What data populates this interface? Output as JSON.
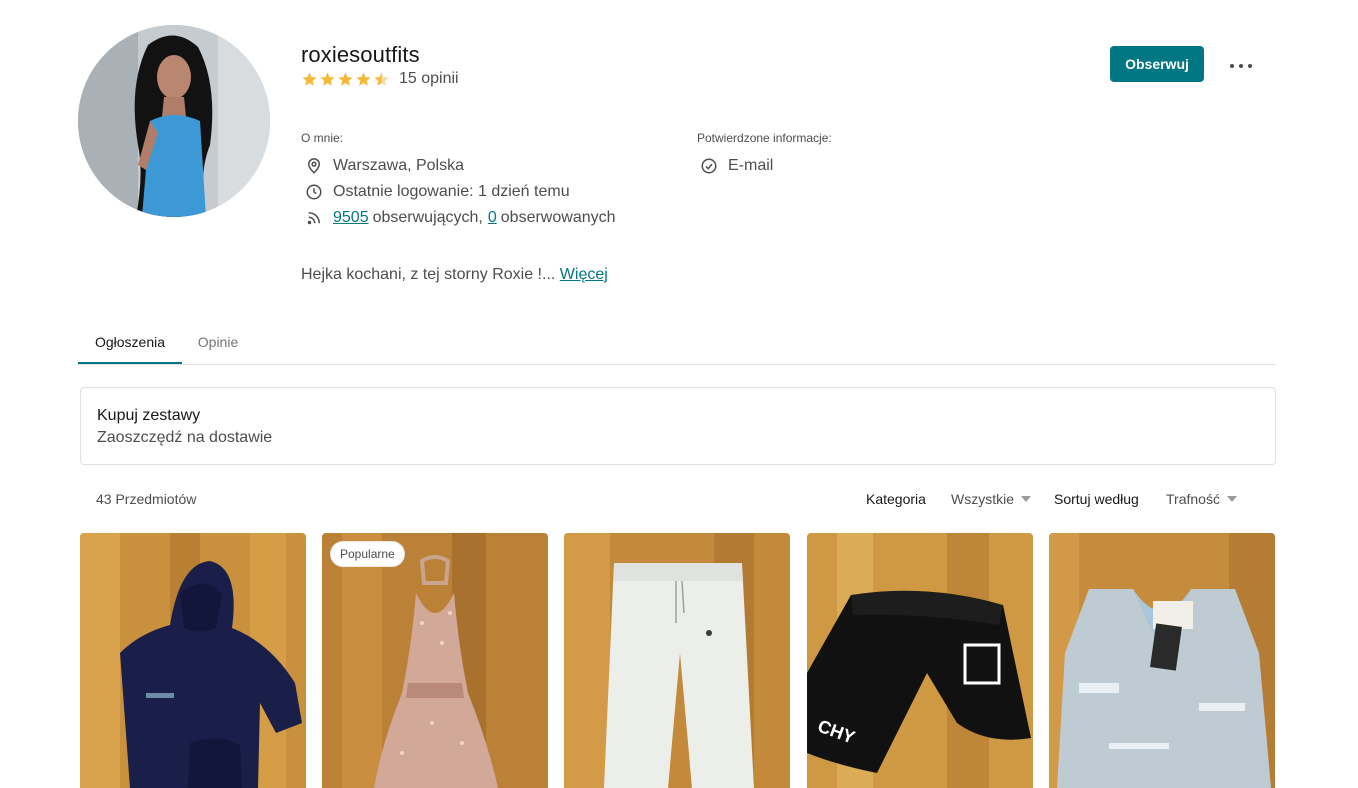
{
  "profile": {
    "username": "roxiesoutfits",
    "rating_value": 4.5,
    "reviews_text": "15 opinii",
    "about_label": "O mnie:",
    "location": "Warszawa, Polska",
    "last_login": "Ostatnie logowanie: 1 dzień temu",
    "followers_count": "9505",
    "followers_label": "obserwujących,",
    "following_count": "0",
    "following_label": "obserwowanych",
    "verified_label": "Potwierdzone informacje:",
    "verified_email": "E-mail",
    "bio": "Hejka kochani, z tej storny Roxie !...",
    "bio_more": "Więcej"
  },
  "actions": {
    "follow_label": "Obserwuj",
    "more_icon": "more-horizontal-icon"
  },
  "tabs": [
    {
      "label": "Ogłoszenia",
      "active": true
    },
    {
      "label": "Opinie",
      "active": false
    }
  ],
  "bundle": {
    "title": "Kupuj zestawy",
    "subtitle": "Zaoszczędź na dostawie"
  },
  "listing": {
    "count": "43 Przedmiotów",
    "category_label": "Kategoria",
    "category_value": "Wszystkie",
    "sort_label": "Sortuj według",
    "sort_value": "Trafność"
  },
  "items": [
    {
      "name": "navy hoodie",
      "badge": ""
    },
    {
      "name": "rose gold sequin dress",
      "badge": "Popularne"
    },
    {
      "name": "white sweatpants",
      "badge": ""
    },
    {
      "name": "black shorts",
      "badge": ""
    },
    {
      "name": "silver metallic vest",
      "badge": ""
    }
  ],
  "colors": {
    "accent": "#007782",
    "star": "#f5b93a",
    "text_muted": "#4d4d4d",
    "border": "#e0e0e0"
  },
  "icons": [
    "location-pin-icon",
    "clock-icon",
    "rss-icon",
    "check-circle-icon",
    "caret-down-icon",
    "star-icon"
  ]
}
